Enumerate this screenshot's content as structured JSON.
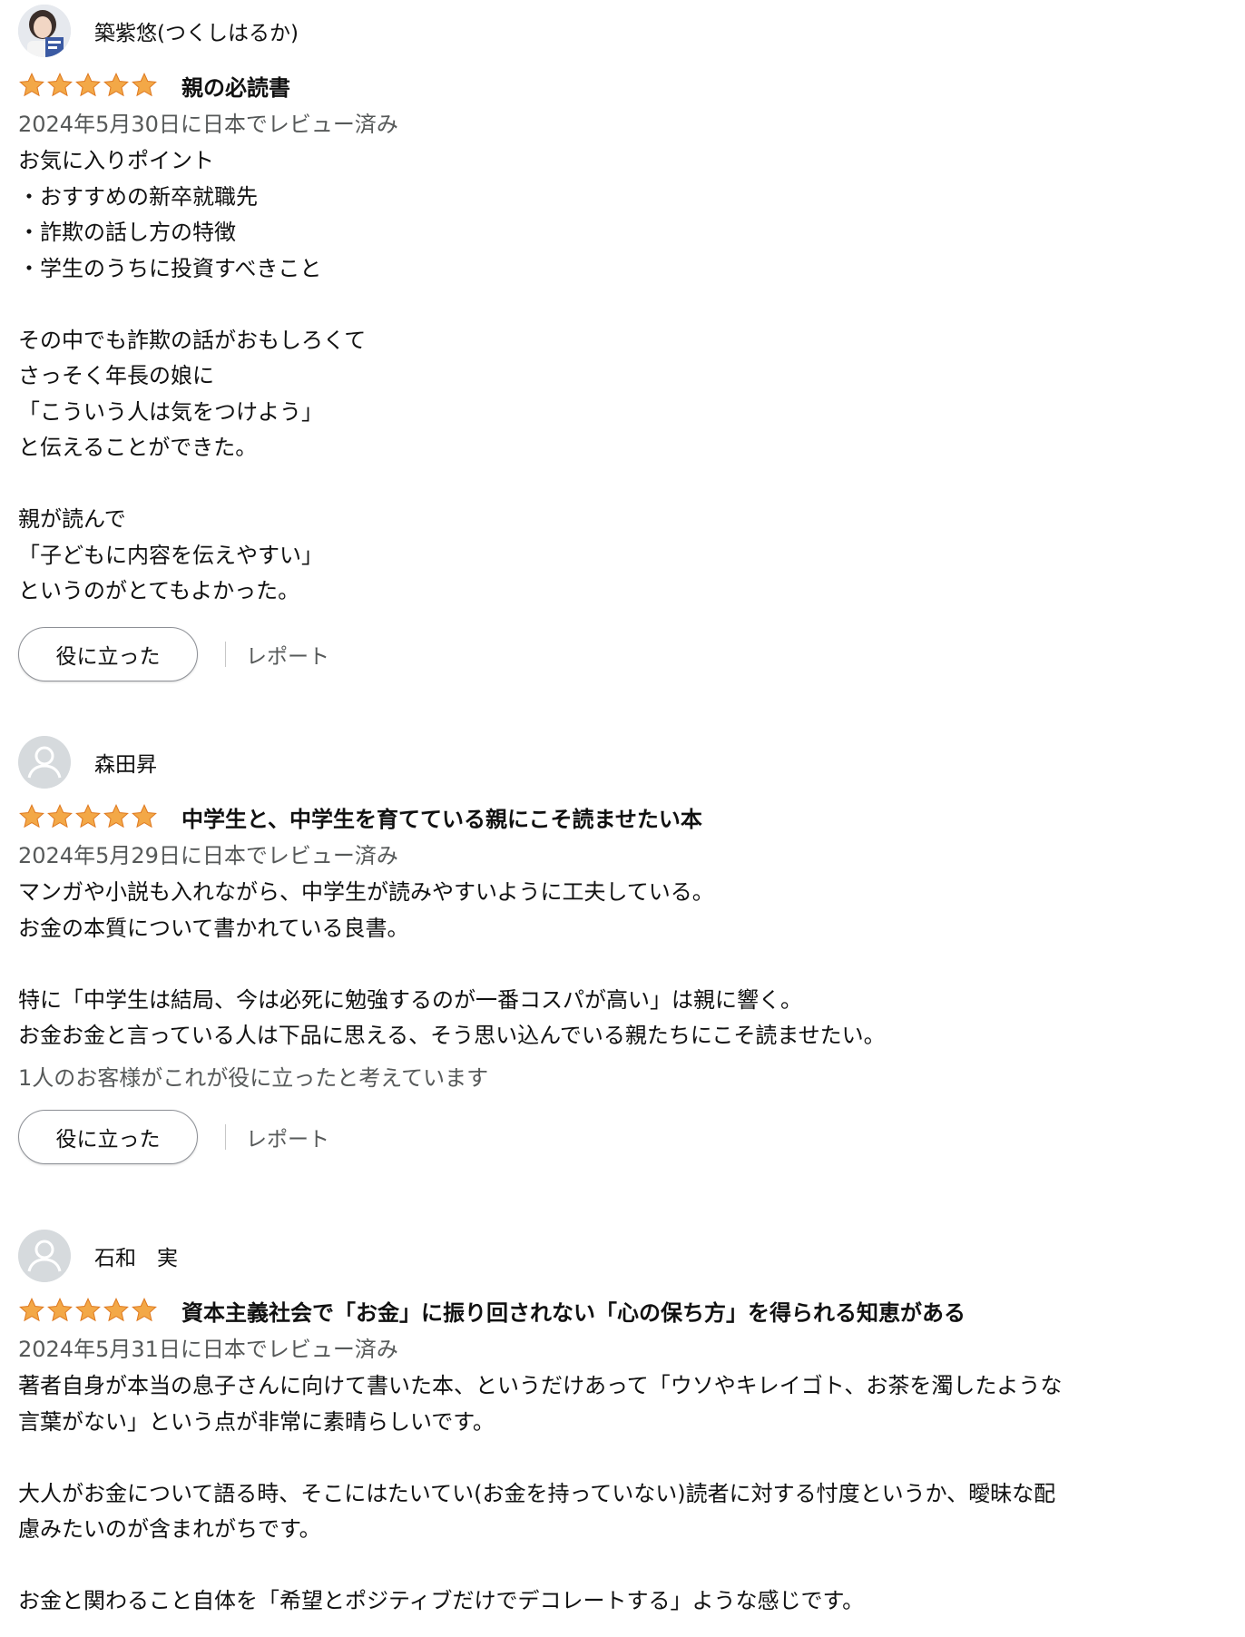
{
  "reviews": [
    {
      "name": "築紫悠(つくしはるか)",
      "avatar": "profile-photo",
      "rating": 5,
      "title": "親の必読書",
      "date": "2024年5月30日に日本でレビュー済み",
      "body": [
        "お気に入りポイント",
        "・おすすめの新卒就職先",
        "・詐欺の話し方の特徴",
        "・学生のうちに投資すべきこと",
        "",
        "その中でも詐欺の話がおもしろくて",
        "さっそく年長の娘に",
        "「こういう人は気をつけよう」",
        "と伝えることができた。",
        "",
        "親が読んで",
        "「子どもに内容を伝えやすい」",
        "というのがとてもよかった。"
      ],
      "helpful_count_text": "",
      "helpful_label": "役に立った",
      "report_label": "レポート"
    },
    {
      "name": "森田昇",
      "avatar": "default-avatar",
      "rating": 5,
      "title": "中学生と、中学生を育てている親にこそ読ませたい本",
      "date": "2024年5月29日に日本でレビュー済み",
      "body": [
        "マンガや小説も入れながら、中学生が読みやすいように工夫している。",
        "お金の本質について書かれている良書。",
        "",
        "特に「中学生は結局、今は必死に勉強するのが一番コスパが高い」は親に響く。",
        "お金お金と言っている人は下品に思える、そう思い込んでいる親たちにこそ読ませたい。"
      ],
      "helpful_count_text": "1人のお客様がこれが役に立ったと考えています",
      "helpful_label": "役に立った",
      "report_label": "レポート"
    },
    {
      "name": "石和　実",
      "avatar": "default-avatar",
      "rating": 5,
      "title": "資本主義社会で「お金」に振り回されない「心の保ち方」を得られる知恵がある",
      "date": "2024年5月31日に日本でレビュー済み",
      "body": [
        "著者自身が本当の息子さんに向けて書いた本、というだけあって「ウソやキレイゴト、お茶を濁したような",
        "言葉がない」という点が非常に素晴らしいです。",
        "",
        "大人がお金について語る時、そこにはたいてい(お金を持っていない)読者に対する忖度というか、曖昧な配",
        "慮みたいのが含まれがちです。",
        "",
        "お金と関わること自体を「希望とポジティブだけでデコレートする」ような感じです。"
      ],
      "helpful_count_text": "",
      "helpful_label": "",
      "report_label": ""
    }
  ],
  "colors": {
    "star": "#f3a847",
    "star_stroke": "#de7921",
    "muted": "#565959"
  }
}
